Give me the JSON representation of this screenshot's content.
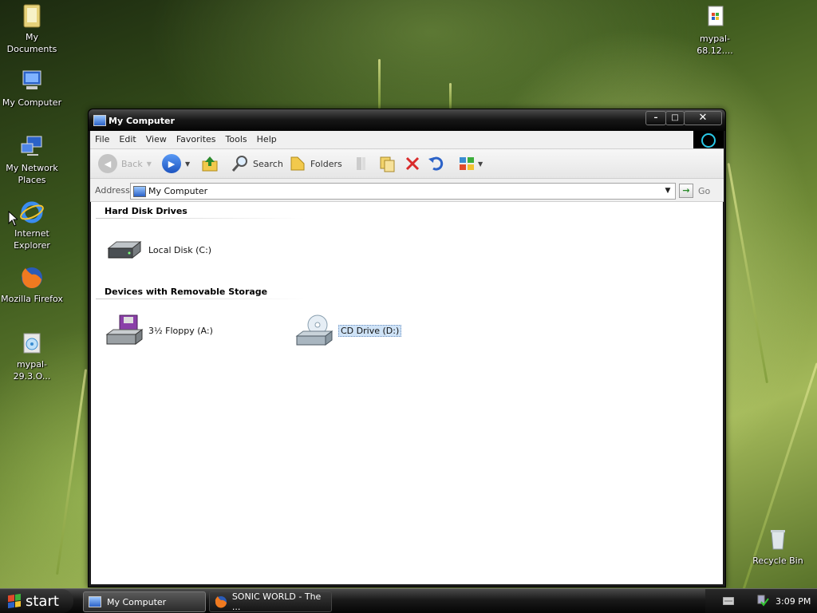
{
  "desktop_icons": {
    "my_documents": "My Documents",
    "my_computer": "My Computer",
    "network_line1": "My Network",
    "network_line2": "Places",
    "ie_line1": "Internet",
    "ie_line2": "Explorer",
    "firefox": "Mozilla Firefox",
    "mypal_installer": "mypal-29.3.O...",
    "mypal_zip": "mypal-68.12....",
    "recycle_bin": "Recycle Bin"
  },
  "window": {
    "title": "My Computer",
    "controls": {
      "minimize": "–",
      "maximize": "□",
      "close": "✕"
    },
    "menu": [
      "File",
      "Edit",
      "View",
      "Favorites",
      "Tools",
      "Help"
    ],
    "toolbar": {
      "back": "Back",
      "search": "Search",
      "folders": "Folders"
    },
    "address": {
      "label": "Address",
      "value": "My Computer",
      "go": "Go"
    },
    "groups": {
      "hard_disks": "Hard Disk Drives",
      "removable": "Devices with Removable Storage"
    },
    "items": {
      "local_disk": "Local Disk (C:)",
      "floppy": "3½ Floppy (A:)",
      "cd_drive": "CD Drive (D:)"
    }
  },
  "taskbar": {
    "start": "start",
    "tasks": [
      "My Computer",
      "SONIC WORLD - The ..."
    ],
    "clock": "3:09 PM"
  },
  "colors": {
    "accent": "#2b62c8",
    "selection": "#cfe3f7",
    "brand_ring": "#29c9e8"
  }
}
